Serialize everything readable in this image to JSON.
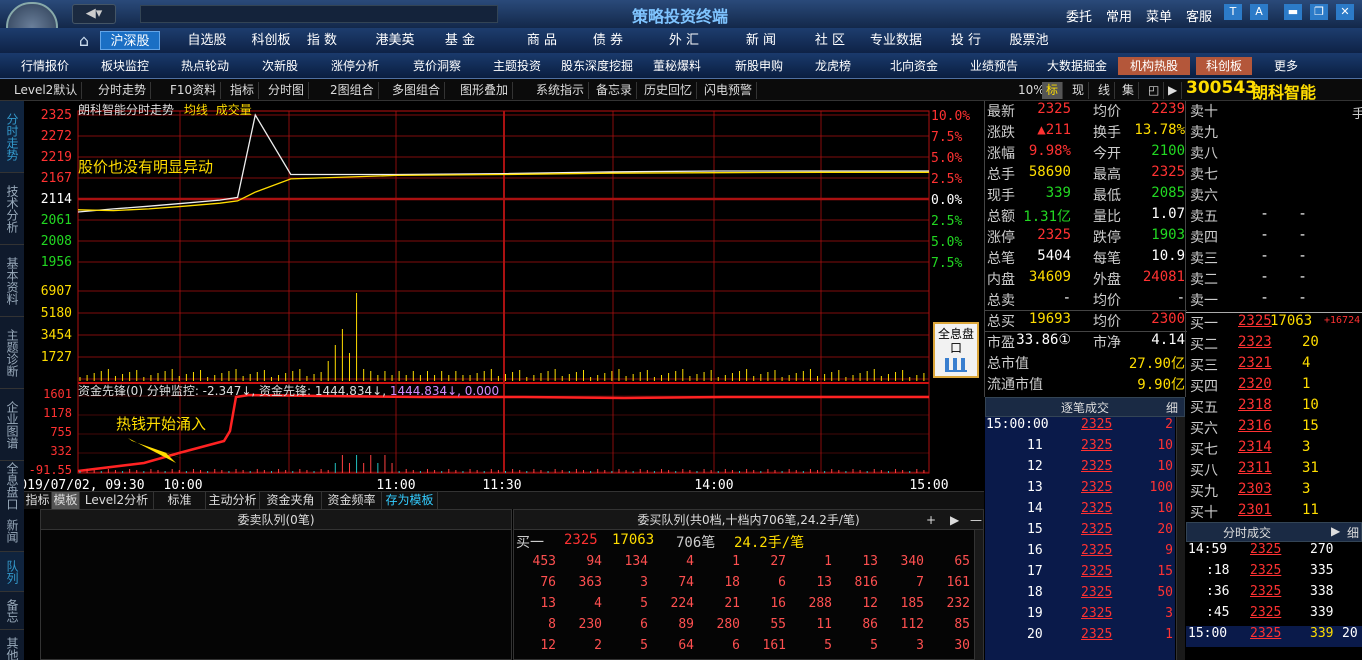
{
  "window": {
    "title": "策略投资终端",
    "menu": [
      "委托",
      "常用",
      "菜单",
      "客服"
    ]
  },
  "nav": [
    {
      "label": "沪深股",
      "active": true
    },
    {
      "label": "自选股"
    },
    {
      "label": "科创板"
    },
    {
      "label": "指 数"
    },
    {
      "label": "港美英"
    },
    {
      "label": "基 金"
    },
    {
      "label": "商 品"
    },
    {
      "label": "债 券"
    },
    {
      "label": "外 汇"
    },
    {
      "label": "新 闻"
    },
    {
      "label": "社 区"
    },
    {
      "label": "专业数据"
    },
    {
      "label": "投 行"
    },
    {
      "label": "股票池"
    }
  ],
  "func": [
    {
      "label": "行情报价"
    },
    {
      "label": "板块监控"
    },
    {
      "label": "热点轮动"
    },
    {
      "label": "次新股"
    },
    {
      "label": "涨停分析"
    },
    {
      "label": "竞价洞察"
    },
    {
      "label": "主题投资"
    },
    {
      "label": "股东深度挖掘"
    },
    {
      "label": "董秘爆料"
    },
    {
      "label": "新股申购"
    },
    {
      "label": "龙虎榜"
    },
    {
      "label": "北向资金"
    },
    {
      "label": "业绩预告"
    },
    {
      "label": "大数据掘金"
    },
    {
      "label": "机构热股",
      "hot": true
    },
    {
      "label": "科创板",
      "hot": true
    },
    {
      "label": "更多"
    }
  ],
  "toolbar": [
    "Level2默认",
    "分时走势",
    "F10资料",
    "指标",
    "分时图",
    "2图组合",
    "多图组合",
    "图形叠加",
    "系统指示",
    "备忘录",
    "历史回忆",
    "闪电预警"
  ],
  "toolbar_right": [
    "10%",
    "标",
    "现",
    "线",
    "集"
  ],
  "side_tabs": [
    "分时走势",
    "技术分析",
    "基本资料",
    "主题诊断",
    "企业图谱",
    "全息盘口",
    "新闻",
    "队列",
    "备忘",
    "其他",
    "股"
  ],
  "stock": {
    "code": "300543",
    "name": "朗科智能"
  },
  "chart": {
    "title": "朗科智能分时走势",
    "avg_label": "均线",
    "vol_label": "成交量",
    "annotation": "股价也没有明显异动",
    "price_ticks": [
      "2325",
      "2272",
      "2219",
      "2167",
      "2114",
      "2061",
      "2008",
      "1956"
    ],
    "pct_ticks": [
      "10.0%",
      "7.5%",
      "5.0%",
      "2.5%",
      "0.0%",
      "2.5%",
      "5.0%",
      "7.5%"
    ],
    "vol_ticks": [
      "6907",
      "5180",
      "3454",
      "1727"
    ],
    "cap_title": "资金先锋(0) 分钟监控: -2.347↓, 资金先锋: 1444.834↓,",
    "cap_val2": "1444.834↓, 0.000",
    "cap_ticks": [
      "1601",
      "1178",
      "755",
      "332",
      "-91.55"
    ],
    "cap_annotation": "热钱开始涌入",
    "time_ticks": [
      "2019/07/02, 09:30",
      "10:00",
      "11:00",
      "11:30",
      "14:00",
      "15:00"
    ],
    "quanxi": "全息盘口"
  },
  "chart_data": {
    "type": "line",
    "x": [
      "09:30",
      "09:40",
      "09:50",
      "10:00",
      "10:10",
      "10:15",
      "10:20",
      "10:30",
      "11:00",
      "11:30",
      "13:30",
      "14:00",
      "14:30",
      "15:00"
    ],
    "ylim": [
      1903,
      2325
    ],
    "series": [
      {
        "name": "分时",
        "values": [
          2105,
          2112,
          2118,
          2125,
          2132,
          2138,
          2325,
          2190,
          2190,
          2192,
          2196,
          2198,
          2198,
          2198
        ]
      },
      {
        "name": "均线",
        "values": [
          2110,
          2108,
          2112,
          2118,
          2125,
          2130,
          2150,
          2180,
          2188,
          2190,
          2193,
          2194,
          2195,
          2195
        ]
      }
    ]
  },
  "quote": [
    [
      "最新",
      "2325",
      "均价",
      "2239"
    ],
    [
      "涨跌",
      "▲211",
      "换手",
      "13.78%"
    ],
    [
      "涨幅",
      "9.98%",
      "今开",
      "2100"
    ],
    [
      "总手",
      "58690",
      "最高",
      "2325"
    ],
    [
      "现手",
      "339",
      "最低",
      "2085"
    ],
    [
      "总额",
      "1.31亿",
      "量比",
      "1.07"
    ],
    [
      "涨停",
      "2325",
      "跌停",
      "1903"
    ],
    [
      "总笔",
      "5404",
      "每笔",
      "10.9"
    ],
    [
      "内盘",
      "34609",
      "外盘",
      "24081"
    ],
    [
      "总卖",
      "-",
      "均价",
      "-"
    ],
    [
      "总买",
      "19693",
      "均价",
      "2300"
    ],
    [
      "市盈",
      "33.86①",
      "市净",
      "4.14"
    ],
    [
      "总市值",
      "",
      "",
      "27.90亿"
    ],
    [
      "流通市值",
      "",
      "",
      "9.90亿"
    ]
  ],
  "asks": [
    [
      "卖十",
      "",
      ""
    ],
    [
      "卖九",
      "",
      ""
    ],
    [
      "卖八",
      "",
      ""
    ],
    [
      "卖七",
      "",
      ""
    ],
    [
      "卖六",
      "",
      ""
    ],
    [
      "卖五",
      "-",
      "-"
    ],
    [
      "卖四",
      "-",
      "-"
    ],
    [
      "卖三",
      "-",
      "-"
    ],
    [
      "卖二",
      "-",
      "-"
    ],
    [
      "卖一",
      "-",
      "-"
    ]
  ],
  "ask_top_extra": "手",
  "bids": [
    [
      "买一",
      "2325",
      "17063",
      "+16724"
    ],
    [
      "买二",
      "2323",
      "20"
    ],
    [
      "买三",
      "2321",
      "4"
    ],
    [
      "买四",
      "2320",
      "1"
    ],
    [
      "买五",
      "2318",
      "10"
    ],
    [
      "买六",
      "2316",
      "15"
    ],
    [
      "买七",
      "2314",
      "3"
    ],
    [
      "买八",
      "2311",
      "31"
    ],
    [
      "买九",
      "2303",
      "3"
    ],
    [
      "买十",
      "2301",
      "11"
    ]
  ],
  "ticks_title": "逐笔成交",
  "ticks_btn": "细",
  "ticks": [
    [
      "15:00:00",
      "2325",
      "2"
    ],
    [
      "11",
      "2325",
      "10"
    ],
    [
      "12",
      "2325",
      "10"
    ],
    [
      "13",
      "2325",
      "100"
    ],
    [
      "14",
      "2325",
      "10"
    ],
    [
      "15",
      "2325",
      "20"
    ],
    [
      "16",
      "2325",
      "9"
    ],
    [
      "17",
      "2325",
      "15"
    ],
    [
      "18",
      "2325",
      "50"
    ],
    [
      "19",
      "2325",
      "3"
    ],
    [
      "20",
      "2325",
      "1"
    ]
  ],
  "min_title": "分时成交",
  "min_btn": "细",
  "min_ticks": [
    [
      "14:59",
      "2325",
      "270"
    ],
    [
      ":18",
      "2325",
      "335"
    ],
    [
      ":36",
      "2325",
      "338"
    ],
    [
      ":45",
      "2325",
      "339"
    ],
    [
      "15:00",
      "2325",
      "339",
      "20"
    ]
  ],
  "bottom_tabs": [
    "指标",
    "模板",
    "Level2分析",
    "标准",
    "主动分析",
    "资金夹角",
    "资金频率",
    "存为模板"
  ],
  "sell_queue_title": "委卖队列(0笔)",
  "buy_queue_title": "委买队列(共0档,十档内706笔,24.2手/笔)",
  "buy_queue_head": [
    "买一",
    "2325",
    "17063",
    "706笔",
    "24.2手/笔"
  ],
  "buy_queue": [
    [
      "453",
      "94",
      "134",
      "4",
      "1",
      "27",
      "1",
      "13",
      "340",
      "65"
    ],
    [
      "76",
      "363",
      "3",
      "74",
      "18",
      "6",
      "13",
      "816",
      "7",
      "161"
    ],
    [
      "13",
      "4",
      "5",
      "224",
      "21",
      "16",
      "288",
      "12",
      "185",
      "232"
    ],
    [
      "8",
      "230",
      "6",
      "89",
      "280",
      "55",
      "11",
      "86",
      "112",
      "85"
    ],
    [
      "12",
      "2",
      "5",
      "64",
      "6",
      "161",
      "5",
      "5",
      "3",
      "30"
    ]
  ]
}
